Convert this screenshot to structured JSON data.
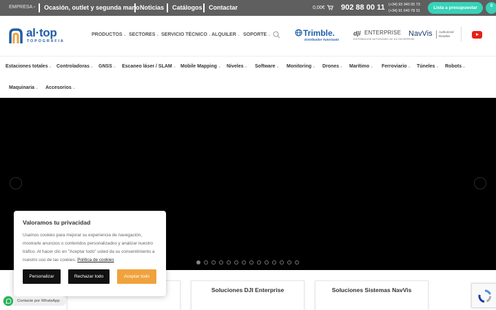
{
  "topbar": {
    "empresa": "EMPRESA",
    "links": [
      "Ocasión, outlet y segunda mano",
      "Noticias",
      "Catálogos",
      "Contactar"
    ],
    "cart_amount": "0,00€",
    "phone_main": "902 88 00 11",
    "phones_secondary": [
      "(+34) 93 340 05 73",
      "(+34) 91 640 78 31"
    ],
    "cta_label": "Lista a presupuestar",
    "cta_count": "0"
  },
  "header": {
    "logo_name": "al·top",
    "logo_sub": "TOPOGRAFIA",
    "nav": [
      "PRODUCTOS",
      "SECTORES",
      "SERVICIO TÉCNICO",
      "ALQUILER",
      "SOPORTE"
    ],
    "brands": {
      "trimble_name": "Trimble.",
      "trimble_tag": "Distribuidor Autorizado",
      "dji_name": "ENTERPRISE",
      "dji_tag": "DISTRIBUIDOR AUTORIZADO DE DJI ENTERPRISE",
      "navvis_name": "NavVis",
      "navvis_tag_1": "Authorized",
      "navvis_tag_2": "Reseller"
    }
  },
  "categories": {
    "row1": [
      "Estaciones totales",
      "Controladoras",
      "GNSS",
      "Escaneo láser / SLAM",
      "Mobile Mapping",
      "Niveles",
      "Software",
      "Monitoring",
      "Drones",
      "Marítimo",
      "Ferroviario",
      "Túneles",
      "Robots"
    ],
    "row2": [
      "Maquinaria",
      "Accesorios"
    ]
  },
  "slider": {
    "slide_count": 14,
    "active_index": 0
  },
  "cards": [
    "Soluciones DJI Enterprise",
    "Soluciones Sistemas NavVis"
  ],
  "cookie": {
    "title": "Valoramos tu privacidad",
    "text": "Usamos cookies para mejorar su experiencia de navegación, mostrarle anuncios o contenidos personalizados y analizar nuestro tráfico. Al hacer clic en \"Aceptar todo\" usted da su consentimiento a nuestro uso de las cookies.",
    "policy_link": "Política de cookies",
    "btn_customize": "Personalizar",
    "btn_reject": "Rechazar todo",
    "btn_accept": "Aceptar todo"
  },
  "whatsapp": {
    "label": "Contacte por WhatsApp"
  },
  "colors": {
    "topbar": "#5f5f5f",
    "accent_teal": "#37d2b8",
    "brand_blue": "#1f5ea8",
    "accept_orange": "#f0a23c"
  }
}
